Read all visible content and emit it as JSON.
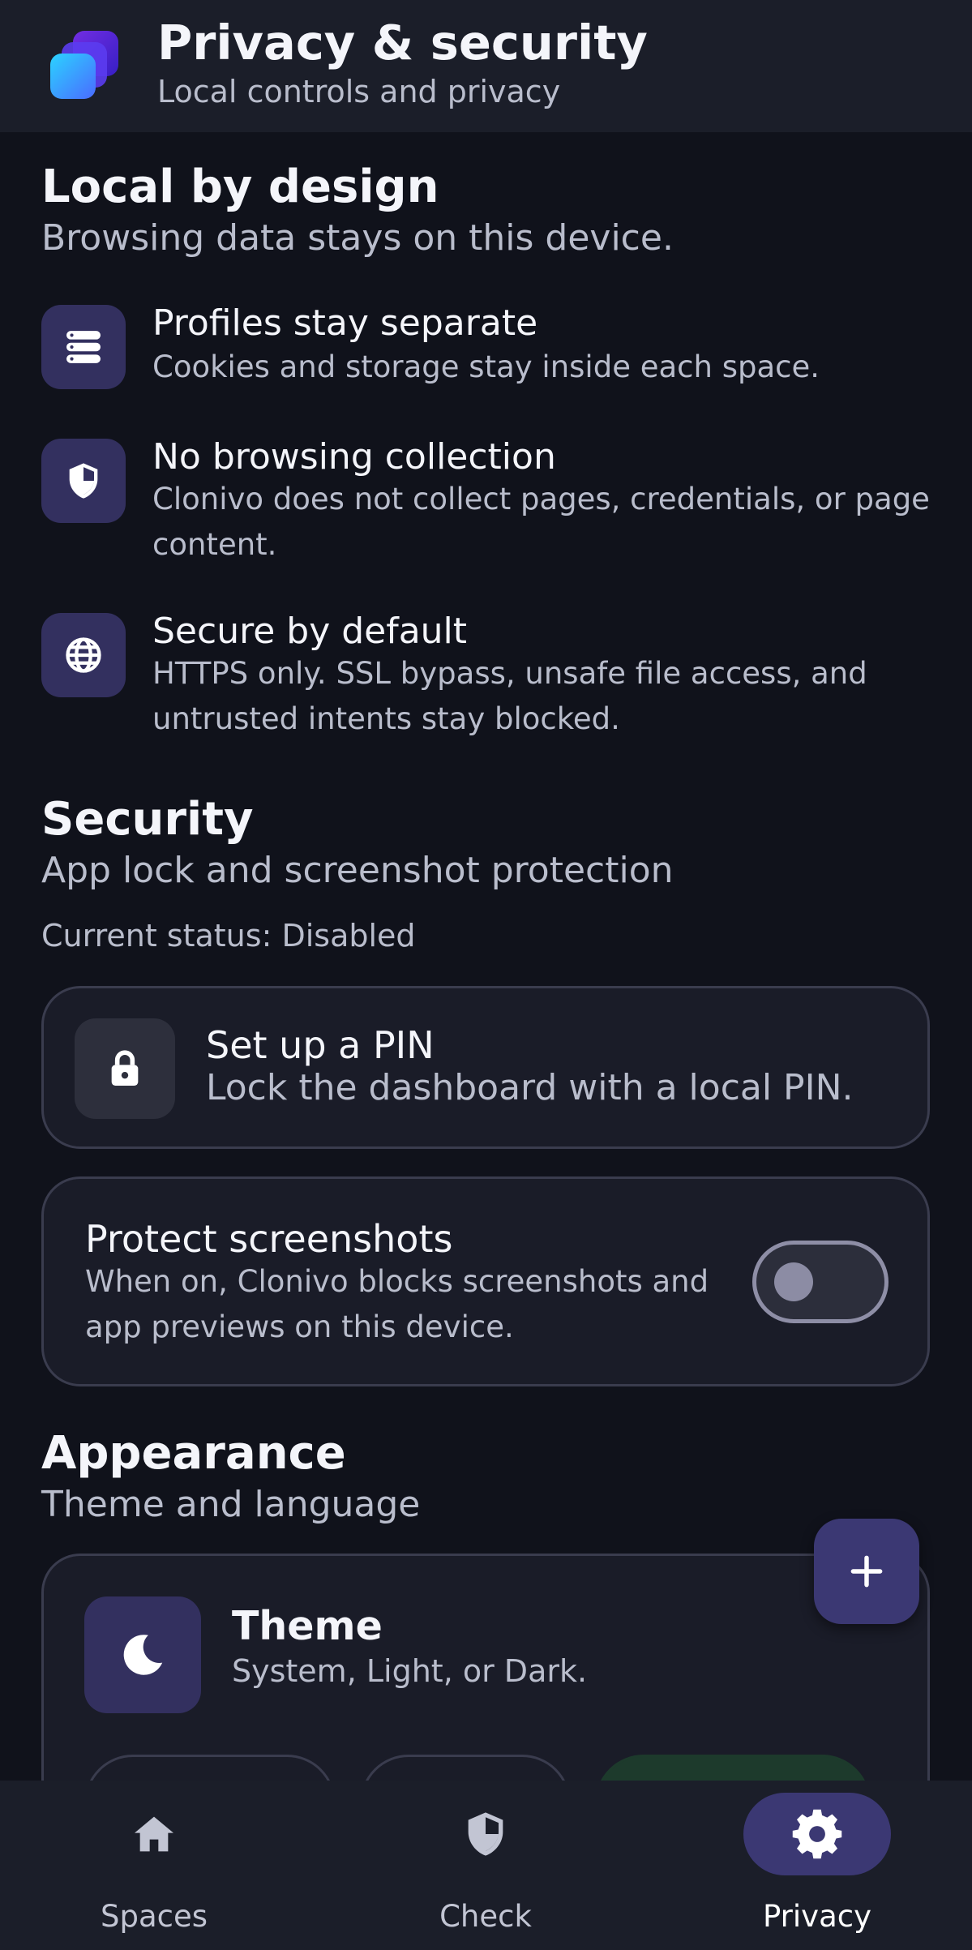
{
  "header": {
    "title": "Privacy & security",
    "subtitle": "Local controls and privacy",
    "logo_icon": "stacked-cubes-logo"
  },
  "local_by_design": {
    "title": "Local by design",
    "subtitle": "Browsing data stays on this device.",
    "items": [
      {
        "icon": "storage-icon",
        "title": "Profiles stay separate",
        "description": "Cookies and storage stay inside each space."
      },
      {
        "icon": "shield-icon",
        "title": "No browsing collection",
        "description": "Clonivo does not collect pages, credentials, or page content."
      },
      {
        "icon": "globe-icon",
        "title": "Secure by default",
        "description": "HTTPS only. SSL bypass, unsafe file access, and untrusted intents stay blocked."
      }
    ]
  },
  "security": {
    "title": "Security",
    "subtitle": "App lock and screenshot protection",
    "status": "Current status: Disabled",
    "pin": {
      "title": "Set up a PIN",
      "description": "Lock the dashboard with a local PIN."
    },
    "screenshots": {
      "title": "Protect screenshots",
      "description": "When on, Clonivo blocks screenshots and app previews on this device.",
      "enabled": false
    }
  },
  "appearance": {
    "title": "Appearance",
    "subtitle": "Theme and language",
    "theme": {
      "title": "Theme",
      "description": "System, Light, or Dark."
    }
  },
  "fab": {
    "icon": "plus-icon"
  },
  "nav": {
    "items": [
      {
        "label": "Spaces",
        "icon": "home-icon",
        "active": false
      },
      {
        "label": "Check",
        "icon": "shield-icon",
        "active": false
      },
      {
        "label": "Privacy",
        "icon": "gear-icon",
        "active": true
      }
    ]
  },
  "colors": {
    "background": "#10121b",
    "surface": "#1b1e29",
    "accent": "#3b3873",
    "icon_tile": "#33305f",
    "selected_option": "#1d3a2c"
  }
}
